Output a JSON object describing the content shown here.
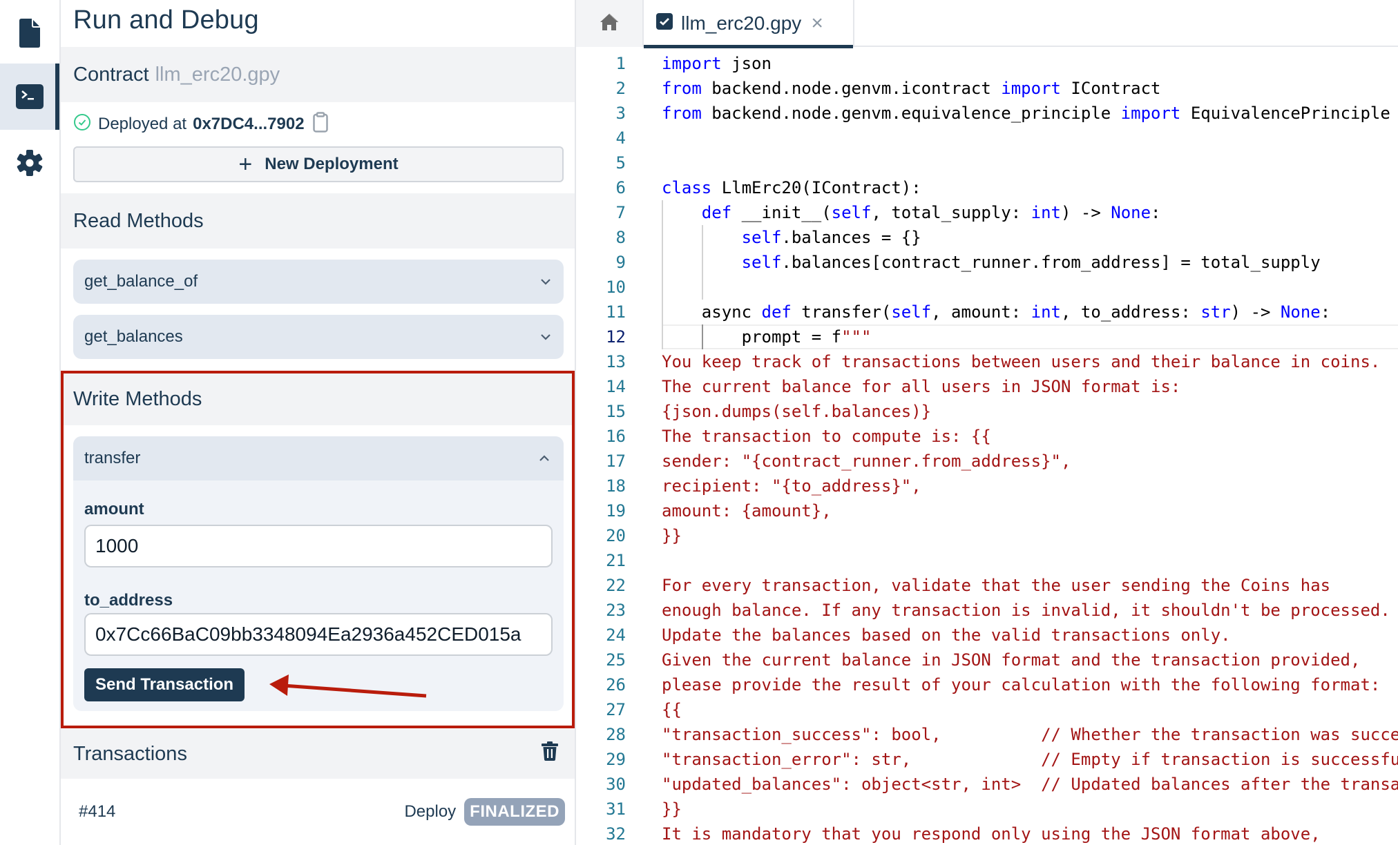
{
  "activity_bar": {
    "items": [
      {
        "icon": "file-icon",
        "active": false
      },
      {
        "icon": "terminal-icon",
        "active": true
      },
      {
        "icon": "gear-icon",
        "active": false
      }
    ]
  },
  "sidebar": {
    "title": "Run and Debug",
    "contract": {
      "label": "Contract",
      "file": "llm_erc20.gpy",
      "deployed_label": "Deployed at",
      "deployed_address": "0x7DC4...7902",
      "new_deployment_label": "New Deployment"
    },
    "read_methods": {
      "title": "Read Methods",
      "items": [
        {
          "name": "get_balance_of",
          "expanded": false
        },
        {
          "name": "get_balances",
          "expanded": false
        }
      ]
    },
    "write_methods": {
      "title": "Write Methods",
      "items": [
        {
          "name": "transfer",
          "expanded": true,
          "fields": [
            {
              "label": "amount",
              "value": "1000"
            },
            {
              "label": "to_address",
              "value": "0x7Cc66BaC09bb3348094Ea2936a452CED015a"
            }
          ],
          "submit_label": "Send Transaction"
        }
      ]
    },
    "transactions": {
      "title": "Transactions",
      "items": [
        {
          "id": "#414",
          "type": "Deploy",
          "status": "FINALIZED"
        }
      ]
    }
  },
  "editor": {
    "tabs": [
      {
        "icon": "home-icon",
        "label": ""
      },
      {
        "icon": "file-check-icon",
        "label": "llm_erc20.gpy",
        "active": true,
        "closable": true
      }
    ],
    "current_line": 12,
    "lines": [
      {
        "n": 1,
        "indent": 0,
        "tokens": [
          [
            "kw",
            "import"
          ],
          [
            "t",
            " json"
          ]
        ]
      },
      {
        "n": 2,
        "indent": 0,
        "tokens": [
          [
            "kw",
            "from"
          ],
          [
            "t",
            " backend.node.genvm.icontract "
          ],
          [
            "kw",
            "import"
          ],
          [
            "t",
            " IContract"
          ]
        ]
      },
      {
        "n": 3,
        "indent": 0,
        "tokens": [
          [
            "kw",
            "from"
          ],
          [
            "t",
            " backend.node.genvm.equivalence_principle "
          ],
          [
            "kw",
            "import"
          ],
          [
            "t",
            " EquivalencePrinciple"
          ]
        ]
      },
      {
        "n": 4,
        "indent": 0,
        "tokens": []
      },
      {
        "n": 5,
        "indent": 0,
        "tokens": []
      },
      {
        "n": 6,
        "indent": 0,
        "tokens": [
          [
            "kw",
            "class"
          ],
          [
            "t",
            " LlmErc20(IContract):"
          ]
        ]
      },
      {
        "n": 7,
        "indent": 1,
        "tokens": [
          [
            "kw",
            "def"
          ],
          [
            "t",
            " __init__("
          ],
          [
            "kw",
            "self"
          ],
          [
            "t",
            ", total_supply: "
          ],
          [
            "kw",
            "int"
          ],
          [
            "t",
            ") -> "
          ],
          [
            "kw",
            "None"
          ],
          [
            "t",
            ":"
          ]
        ]
      },
      {
        "n": 8,
        "indent": 2,
        "tokens": [
          [
            "kw",
            "self"
          ],
          [
            "t",
            ".balances = {}"
          ]
        ]
      },
      {
        "n": 9,
        "indent": 2,
        "tokens": [
          [
            "kw",
            "self"
          ],
          [
            "t",
            ".balances[contract_runner.from_address] = total_supply"
          ]
        ]
      },
      {
        "n": 10,
        "indent": 2,
        "tokens": []
      },
      {
        "n": 11,
        "indent": 1,
        "tokens": [
          [
            "t",
            "async "
          ],
          [
            "kw",
            "def"
          ],
          [
            "t",
            " transfer("
          ],
          [
            "kw",
            "self"
          ],
          [
            "t",
            ", amount: "
          ],
          [
            "kw",
            "int"
          ],
          [
            "t",
            ", to_address: "
          ],
          [
            "kw",
            "str"
          ],
          [
            "t",
            ") -> "
          ],
          [
            "kw",
            "None"
          ],
          [
            "t",
            ":"
          ]
        ]
      },
      {
        "n": 12,
        "indent": 2,
        "tokens": [
          [
            "t",
            "prompt = f"
          ],
          [
            "str",
            "\"\"\""
          ]
        ]
      },
      {
        "n": 13,
        "indent": 0,
        "tokens": [
          [
            "str",
            "You keep track of transactions between users and their balance in coins."
          ]
        ]
      },
      {
        "n": 14,
        "indent": 0,
        "tokens": [
          [
            "str",
            "The current balance for all users in JSON format is:"
          ]
        ]
      },
      {
        "n": 15,
        "indent": 0,
        "tokens": [
          [
            "str",
            "{json.dumps(self.balances)}"
          ]
        ]
      },
      {
        "n": 16,
        "indent": 0,
        "tokens": [
          [
            "str",
            "The transaction to compute is: {{"
          ]
        ]
      },
      {
        "n": 17,
        "indent": 0,
        "tokens": [
          [
            "str",
            "sender: \"{contract_runner.from_address}\","
          ]
        ]
      },
      {
        "n": 18,
        "indent": 0,
        "tokens": [
          [
            "str",
            "recipient: \"{to_address}\","
          ]
        ]
      },
      {
        "n": 19,
        "indent": 0,
        "tokens": [
          [
            "str",
            "amount: {amount},"
          ]
        ]
      },
      {
        "n": 20,
        "indent": 0,
        "tokens": [
          [
            "str",
            "}}"
          ]
        ]
      },
      {
        "n": 21,
        "indent": 0,
        "tokens": []
      },
      {
        "n": 22,
        "indent": 0,
        "tokens": [
          [
            "str",
            "For every transaction, validate that the user sending the Coins has"
          ]
        ]
      },
      {
        "n": 23,
        "indent": 0,
        "tokens": [
          [
            "str",
            "enough balance. If any transaction is invalid, it shouldn't be processed."
          ]
        ]
      },
      {
        "n": 24,
        "indent": 0,
        "tokens": [
          [
            "str",
            "Update the balances based on the valid transactions only."
          ]
        ]
      },
      {
        "n": 25,
        "indent": 0,
        "tokens": [
          [
            "str",
            "Given the current balance in JSON format and the transaction provided,"
          ]
        ]
      },
      {
        "n": 26,
        "indent": 0,
        "tokens": [
          [
            "str",
            "please provide the result of your calculation with the following format:"
          ]
        ]
      },
      {
        "n": 27,
        "indent": 0,
        "tokens": [
          [
            "str",
            "{{"
          ]
        ]
      },
      {
        "n": 28,
        "indent": 0,
        "tokens": [
          [
            "str",
            "\"transaction_success\": bool,          // Whether the transaction was successful"
          ]
        ]
      },
      {
        "n": 29,
        "indent": 0,
        "tokens": [
          [
            "str",
            "\"transaction_error\": str,             // Empty if transaction is successful"
          ]
        ]
      },
      {
        "n": 30,
        "indent": 0,
        "tokens": [
          [
            "str",
            "\"updated_balances\": object<str, int>  // Updated balances after the transaction"
          ]
        ]
      },
      {
        "n": 31,
        "indent": 0,
        "tokens": [
          [
            "str",
            "}}"
          ]
        ]
      },
      {
        "n": 32,
        "indent": 0,
        "tokens": [
          [
            "str",
            "It is mandatory that you respond only using the JSON format above,"
          ]
        ]
      }
    ]
  },
  "annotation": {
    "highlight": "write-methods-section",
    "arrow_target": "send-transaction-button",
    "color": "#b91c0c"
  },
  "colors": {
    "primary": "#1e3a52",
    "keyword": "#0000ff",
    "string": "#a31515",
    "line_number": "#237893",
    "success": "#34c98b",
    "badge_finalized": "#94a3b8"
  }
}
